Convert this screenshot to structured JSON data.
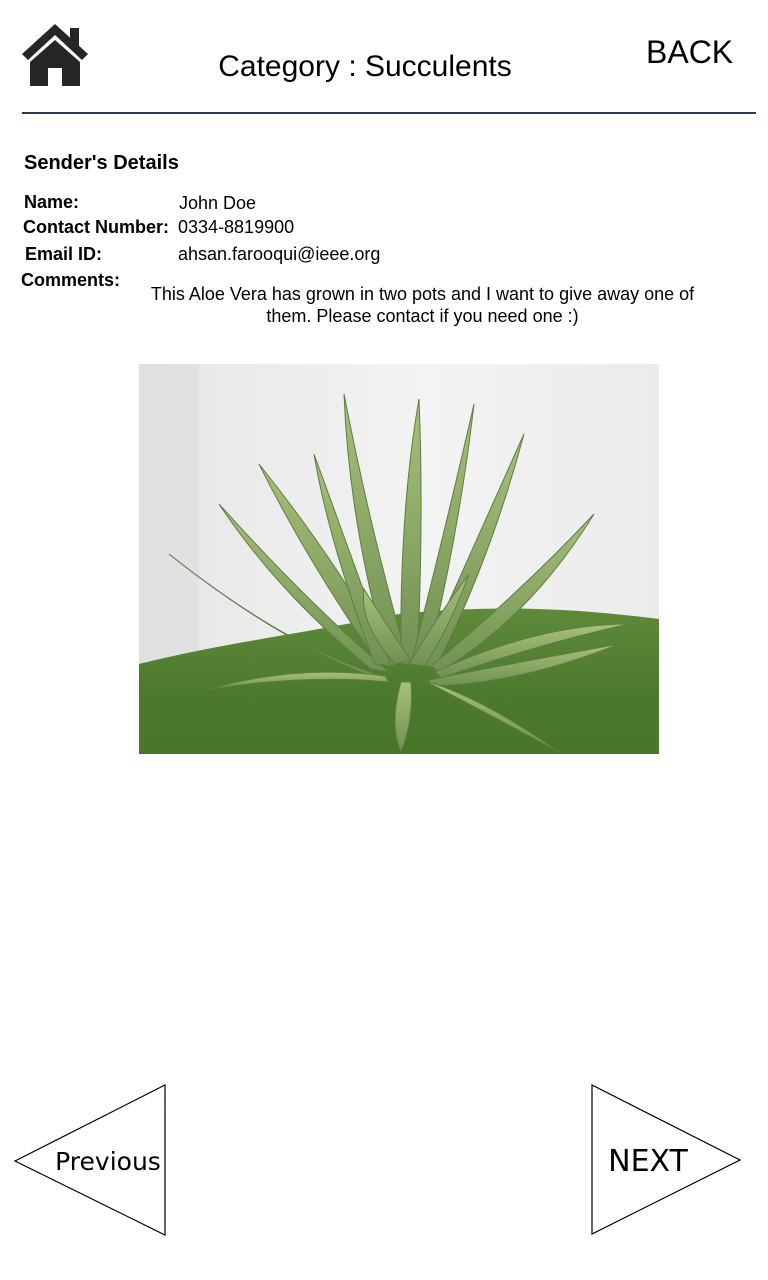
{
  "header": {
    "home_icon": "home-icon",
    "title": "Category : Succulents",
    "back_label": "BACK"
  },
  "sender": {
    "section_title": "Sender's Details",
    "name_label": "Name:",
    "name_value": "John Doe",
    "contact_label": "Contact Number:",
    "contact_value": "0334-8819900",
    "email_label": "Email ID:",
    "email_value": "ahsan.farooqui@ieee.org",
    "comments_label": "Comments:",
    "comments_value": "This Aloe Vera has grown in two pots and I want to give away one of them. Please contact if you need one :)"
  },
  "photo": {
    "subject": "aloe-vera-plant-photo"
  },
  "navigation": {
    "previous_label": "Previous",
    "next_label": "NEXT"
  },
  "colors": {
    "divider": "#2b3b55",
    "icon": "#262626"
  }
}
